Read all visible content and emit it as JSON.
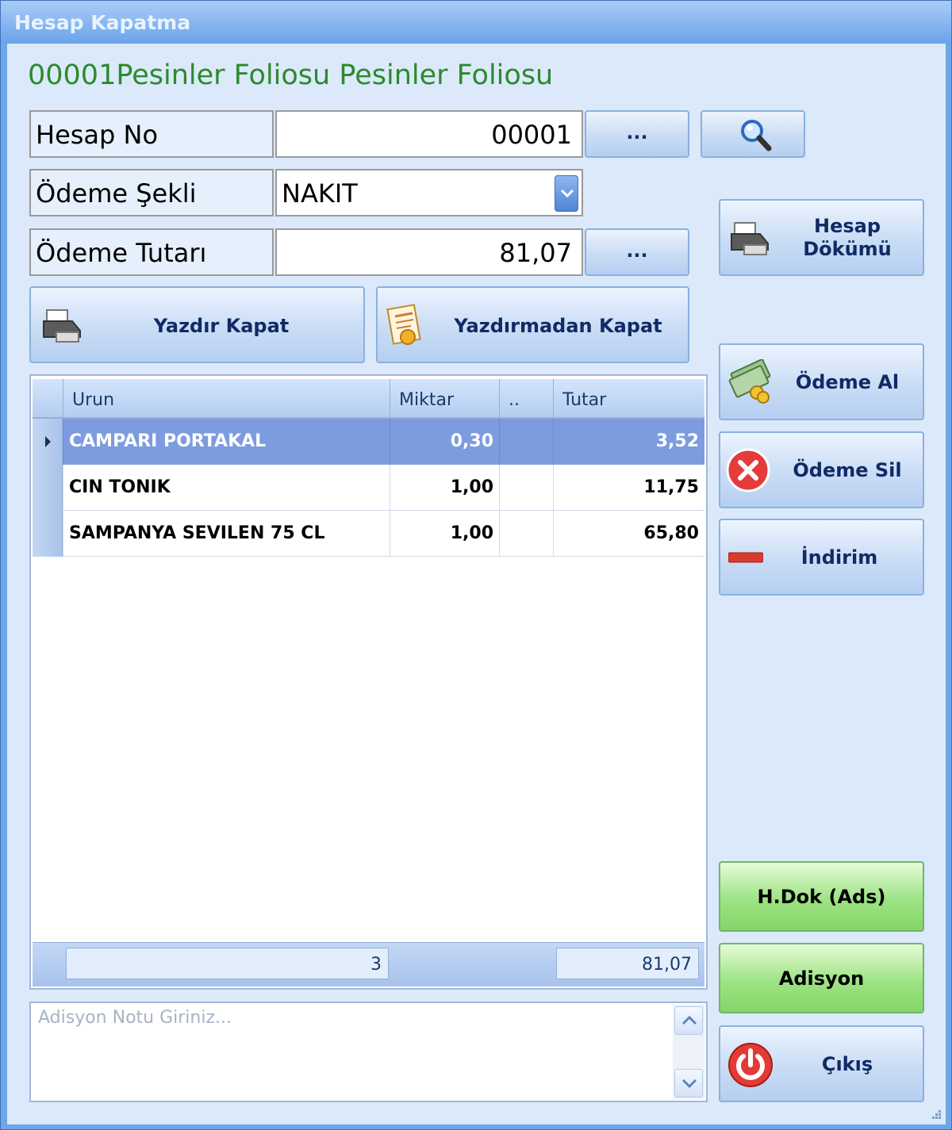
{
  "window": {
    "title": "Hesap Kapatma"
  },
  "heading": "00001Pesinler Foliosu Pesinler Foliosu",
  "form": {
    "hesap_no_label": "Hesap  No",
    "hesap_no_value": "00001",
    "odeme_sekli_label": "Ödeme Şekli",
    "odeme_sekli_value": "NAKIT",
    "odeme_tutari_label": "Ödeme Tutarı",
    "odeme_tutari_value": "81,07",
    "browse_label": "..."
  },
  "buttons": {
    "yazdir_kapat": "Yazdır Kapat",
    "yazdirmadan_kapat": "Yazdırmadan Kapat",
    "hesap_dokumu_line1": "Hesap",
    "hesap_dokumu_line2": "Dökümü",
    "odeme_al": "Ödeme Al",
    "odeme_sil": "Ödeme Sil",
    "indirim": "İndirim",
    "hdok_ads": "H.Dok (Ads)",
    "adisyon": "Adisyon",
    "cikis": "Çıkış"
  },
  "grid": {
    "columns": [
      "Urun",
      "Miktar",
      "..",
      "Tutar"
    ],
    "rows": [
      {
        "urun": "CAMPARI PORTAKAL",
        "miktar": "0,30",
        "extra": "",
        "tutar": "3,52",
        "selected": true
      },
      {
        "urun": "CIN TONIK",
        "miktar": "1,00",
        "extra": "",
        "tutar": "11,75",
        "selected": false
      },
      {
        "urun": "SAMPANYA SEVILEN 75 CL",
        "miktar": "1,00",
        "extra": "",
        "tutar": "65,80",
        "selected": false
      }
    ],
    "footer": {
      "count": "3",
      "total": "81,07"
    }
  },
  "note": {
    "placeholder": "Adisyon Notu Giriniz..."
  },
  "icons": {
    "search": "magnifier-icon",
    "printer": "printer-icon",
    "receipt": "receipt-icon",
    "money": "money-icon",
    "delete": "red-x-icon",
    "discount": "minus-icon",
    "power": "power-icon"
  },
  "colors": {
    "heading": "#2c8a2c",
    "selected_row": "#7d9cdf",
    "green_button": "#9de383"
  }
}
